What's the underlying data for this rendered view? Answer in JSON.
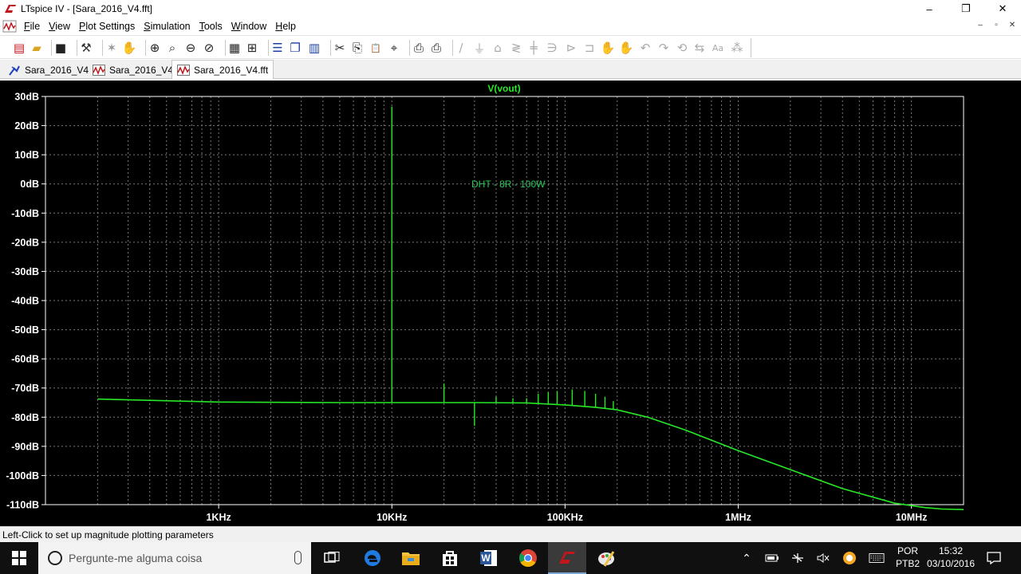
{
  "window": {
    "title": "LTspice IV - [Sara_2016_V4.fft]",
    "controls": [
      "–",
      "❐",
      "✕"
    ]
  },
  "menu": {
    "items": [
      {
        "label": "File",
        "underline": "F"
      },
      {
        "label": "View",
        "underline": "V"
      },
      {
        "label": "Plot Settings",
        "underline": "P"
      },
      {
        "label": "Simulation",
        "underline": "S"
      },
      {
        "label": "Tools",
        "underline": "T"
      },
      {
        "label": "Window",
        "underline": "W"
      },
      {
        "label": "Help",
        "underline": "H"
      }
    ],
    "mdi_controls": [
      "–",
      "▫",
      "✕"
    ]
  },
  "toolbar": {
    "buttons": [
      "new-schematic-icon",
      "open-icon",
      "save-icon",
      "control-panel-icon",
      "run-icon",
      "halt-icon",
      "zoom-in-icon",
      "zoom-area-icon",
      "zoom-out-icon",
      "zoom-cancel-icon",
      "autorange-icon",
      "grid-icon",
      "tile-horizontal-icon",
      "cascade-icon",
      "tile-vertical-icon",
      "cut-icon",
      "copy-icon",
      "paste-icon",
      "find-icon",
      "print-preview-icon",
      "print-icon",
      "wire-icon",
      "ground-icon",
      "label-icon",
      "resistor-icon",
      "capacitor-icon",
      "inductor-icon",
      "diode-icon",
      "component-icon",
      "move-icon",
      "drag-icon",
      "undo-icon",
      "redo-icon",
      "rotate-icon",
      "mirror-icon",
      "text-icon",
      "spice-directive-icon"
    ]
  },
  "colors": {
    "trace": "#27e827",
    "grid": "#7a7a7a",
    "plot_bg": "#000000",
    "axis_text": "#ffffff"
  },
  "tabs": [
    {
      "label": "Sara_2016_V4",
      "icon": "schematic-icon",
      "active": false
    },
    {
      "label": "Sara_2016_V4",
      "icon": "waveform-icon",
      "active": false
    },
    {
      "label": "Sara_2016_V4.fft",
      "icon": "waveform-icon",
      "active": true
    }
  ],
  "status": {
    "text": "Left-Click to set up magnitude plotting parameters"
  },
  "taskbar": {
    "search_placeholder": "Pergunte-me alguma coisa",
    "language": "POR",
    "keyboard": "PTB2",
    "time": "15:32",
    "date": "03/10/2016",
    "apps": [
      "task-view-icon",
      "edge-icon",
      "file-explorer-icon",
      "store-icon",
      "word-icon",
      "chrome-icon",
      "ltspice-icon",
      "paint-icon"
    ]
  },
  "chart_data": {
    "type": "line",
    "title": "V(vout)",
    "annotation": "DHT - 8R - 100W",
    "x_scale": "log",
    "xlim": [
      100,
      20000000
    ],
    "ylim": [
      -110,
      30
    ],
    "x_ticks": [
      {
        "value": 1000,
        "label": "1KHz"
      },
      {
        "value": 10000,
        "label": "10KHz"
      },
      {
        "value": 100000,
        "label": "100KHz"
      },
      {
        "value": 1000000,
        "label": "1MHz"
      },
      {
        "value": 10000000,
        "label": "10MHz"
      }
    ],
    "y_ticks": [
      {
        "value": 30,
        "label": "30dB"
      },
      {
        "value": 20,
        "label": "20dB"
      },
      {
        "value": 10,
        "label": "10dB"
      },
      {
        "value": 0,
        "label": "0dB"
      },
      {
        "value": -10,
        "label": "-10dB"
      },
      {
        "value": -20,
        "label": "-20dB"
      },
      {
        "value": -30,
        "label": "-30dB"
      },
      {
        "value": -40,
        "label": "-40dB"
      },
      {
        "value": -50,
        "label": "-50dB"
      },
      {
        "value": -60,
        "label": "-60dB"
      },
      {
        "value": -70,
        "label": "-70dB"
      },
      {
        "value": -80,
        "label": "-80dB"
      },
      {
        "value": -90,
        "label": "-90dB"
      },
      {
        "value": -100,
        "label": "-100dB"
      },
      {
        "value": -110,
        "label": "-110dB"
      }
    ],
    "grid": true,
    "series": [
      {
        "name": "V(vout)",
        "x": [
          200,
          1000,
          5000,
          10000,
          30000,
          60000,
          100000,
          150000,
          200000,
          300000,
          500000,
          1000000,
          2000000,
          4000000,
          8000000,
          12000000,
          15000000,
          20000000
        ],
        "y": [
          -73.8,
          -74.8,
          -75.0,
          -75.0,
          -75.0,
          -75.1,
          -75.8,
          -76.6,
          -77.5,
          -80.0,
          -84.5,
          -91.5,
          -98.0,
          -104.5,
          -109.5,
          -111.0,
          -111.5,
          -111.7
        ]
      }
    ],
    "peaks": [
      {
        "x": 10000,
        "y": 26.5
      },
      {
        "x": 20000,
        "y": -68.5
      },
      {
        "x": 30000,
        "y": -83.0
      },
      {
        "x": 40000,
        "y": -73.0
      },
      {
        "x": 50000,
        "y": -73.5
      },
      {
        "x": 60000,
        "y": -73.5
      },
      {
        "x": 70000,
        "y": -72.0
      },
      {
        "x": 80000,
        "y": -71.5
      },
      {
        "x": 90000,
        "y": -71.0
      },
      {
        "x": 110000,
        "y": -70.5
      },
      {
        "x": 130000,
        "y": -71.0
      },
      {
        "x": 150000,
        "y": -72.0
      },
      {
        "x": 170000,
        "y": -73.0
      },
      {
        "x": 190000,
        "y": -74.5
      }
    ]
  }
}
